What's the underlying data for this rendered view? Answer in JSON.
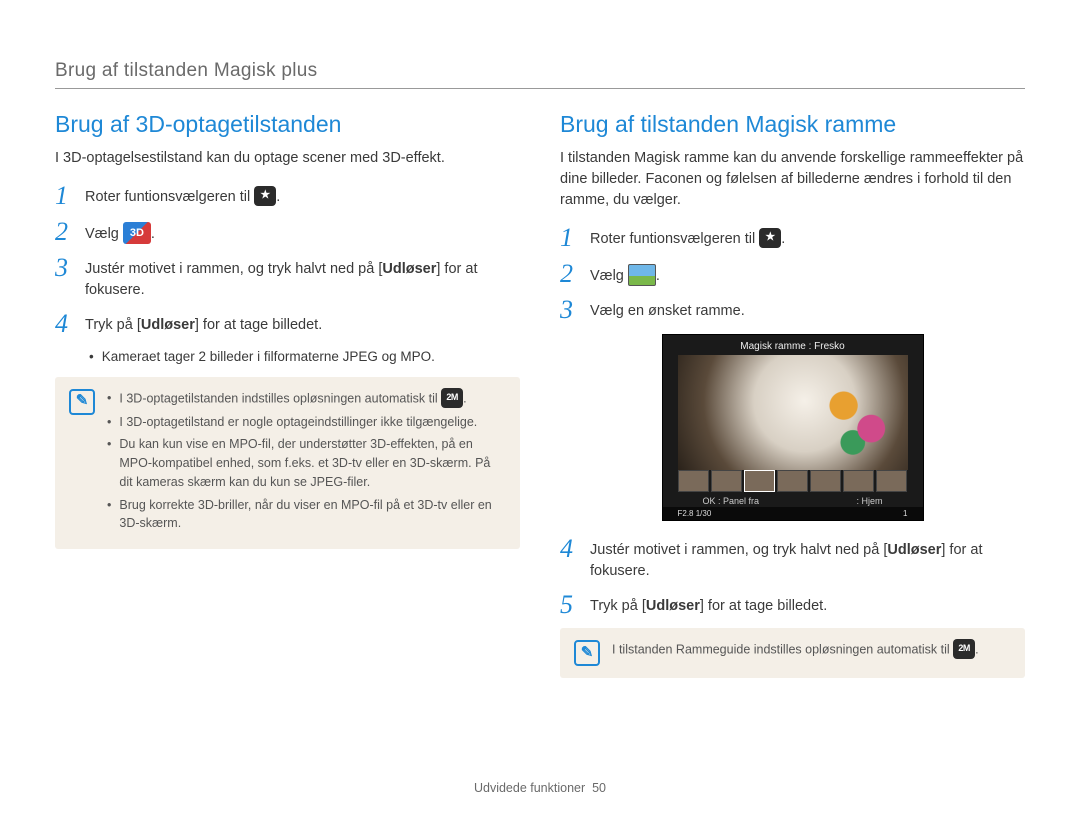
{
  "header": "Brug af tilstanden Magisk plus",
  "left": {
    "heading": "Brug af 3D-optagetilstanden",
    "intro": "I 3D-optagelsestilstand kan du optage scener med 3D-effekt.",
    "steps": {
      "s1_pre": "Roter funtionsvælgeren til ",
      "s1_post": ".",
      "s2_pre": "Vælg ",
      "s2_post": ".",
      "s3_a": "Justér motivet i rammen, og tryk halvt ned på [",
      "s3_b": "Udløser",
      "s3_c": "] for at fokusere.",
      "s4_a": "Tryk på [",
      "s4_b": "Udløser",
      "s4_c": "] for at tage billedet."
    },
    "bullet": "Kameraet tager 2 billeder i filformaterne JPEG og MPO.",
    "info": {
      "i1_pre": "I 3D-optagetilstanden indstilles opløsningen automatisk til ",
      "i1_post": ".",
      "i2": "I 3D-optagetilstand er nogle optageindstillinger ikke tilgængelige.",
      "i3": "Du kan kun vise en MPO-fil, der understøtter 3D-effekten, på en MPO-kompatibel enhed, som f.eks. et 3D-tv eller en 3D-skærm. På dit kameras skærm kan du kun se JPEG-filer.",
      "i4": "Brug korrekte 3D-briller, når du viser en MPO-fil på et 3D-tv eller en 3D-skærm."
    }
  },
  "right": {
    "heading": "Brug af tilstanden Magisk ramme",
    "intro": "I tilstanden Magisk ramme kan du anvende forskellige rammeeffekter på dine billeder. Faconen og følelsen af billederne ændres i forhold til den ramme, du vælger.",
    "steps": {
      "s1_pre": "Roter funtionsvælgeren til ",
      "s1_post": ".",
      "s2_pre": "Vælg ",
      "s2_post": ".",
      "s3": "Vælg en ønsket ramme.",
      "s4_a": "Justér motivet i rammen, og tryk halvt ned på [",
      "s4_b": "Udløser",
      "s4_c": "] for at fokusere.",
      "s5_a": "Tryk på [",
      "s5_b": "Udløser",
      "s5_c": "] for at tage billedet."
    },
    "screenshot": {
      "title": "Magisk ramme : Fresko",
      "ok": "OK : Panel fra",
      "home": ": Hjem",
      "exposure": "F2.8  1/30",
      "count": "1"
    },
    "info_pre": "I tilstanden Rammeguide indstilles opløsningen automatisk til ",
    "info_post": "."
  },
  "footer": {
    "section": "Udvidede funktioner",
    "page": "50"
  }
}
